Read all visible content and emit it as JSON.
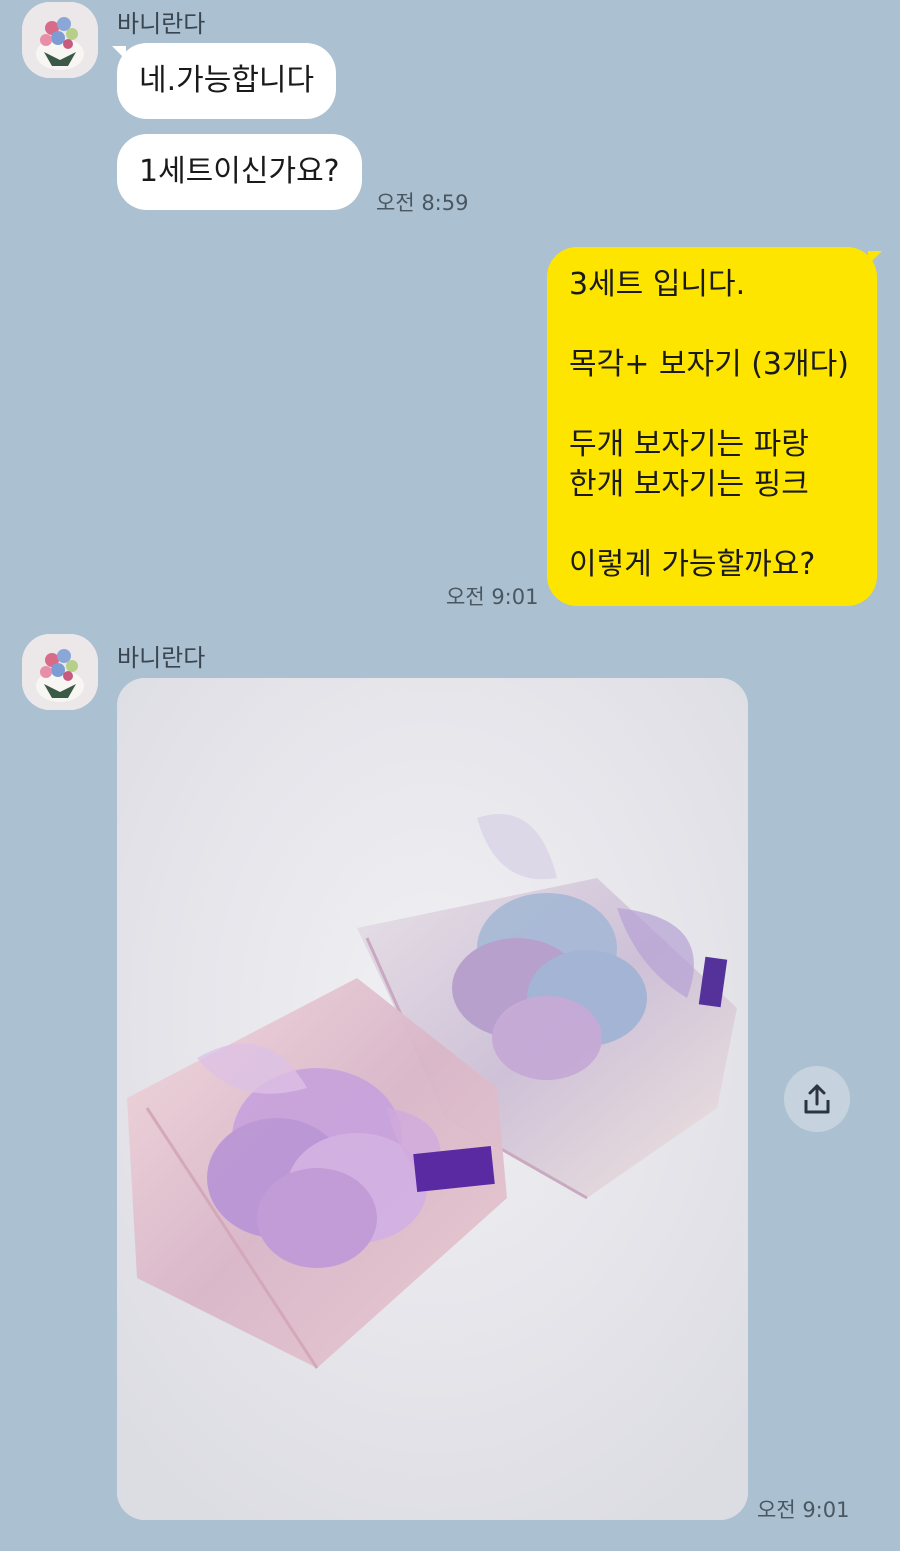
{
  "messages": {
    "sender1": "바니란다",
    "m1": "네.가능합니다",
    "m2": "1세트이신가요?",
    "t1": "오전 8:59",
    "out": "3세트 입니다.\n\n목각+ 보자기 (3개다)\n\n두개 보자기는 파랑\n한개 보자기는 핑크\n\n이렇게 가능할까요?",
    "t2": "오전 9:01",
    "sender2": "바니란다",
    "t3": "오전 9:01"
  },
  "icons": {
    "share": "share-icon",
    "avatar": "flower-bouquet-avatar"
  },
  "colors": {
    "background": "#abc1d1",
    "incoming_bubble": "#ffffff",
    "outgoing_bubble": "#fee500"
  }
}
